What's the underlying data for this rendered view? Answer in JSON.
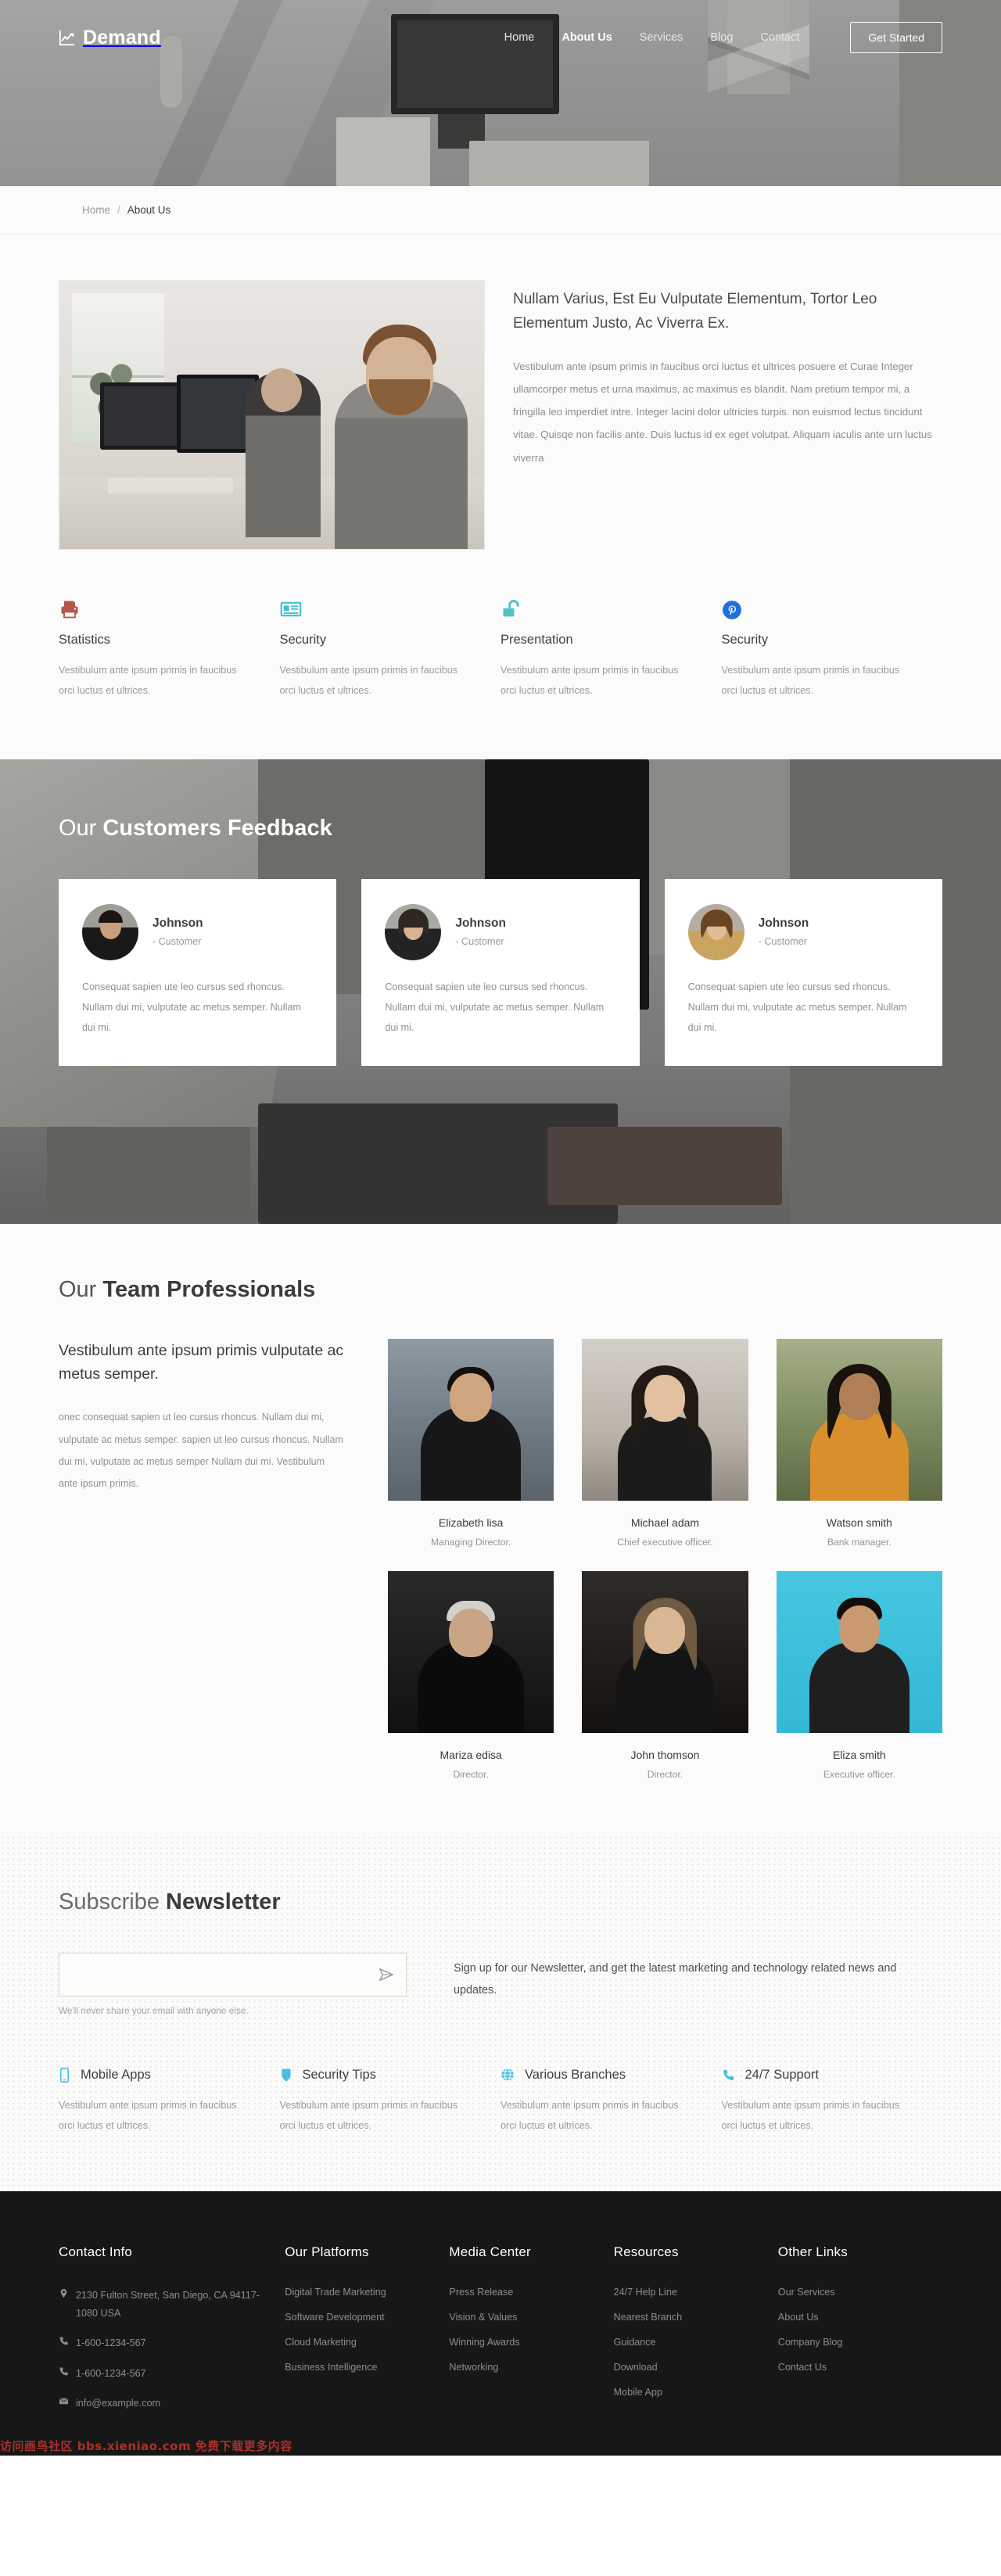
{
  "header": {
    "brand": "Demand",
    "brand_icon": "chart-line-icon",
    "nav": [
      {
        "label": "Home",
        "active": false
      },
      {
        "label": "About Us",
        "active": true
      },
      {
        "label": "Services",
        "active": false
      },
      {
        "label": "Blog",
        "active": false
      },
      {
        "label": "Contact",
        "active": false
      }
    ],
    "cta": "Get Started"
  },
  "breadcrumb": {
    "home": "Home",
    "separator": "/",
    "current": "About Us"
  },
  "about": {
    "title": "Nullam Varius, Est Eu Vulputate Elementum, Tortor Leo Elementum Justo, Ac Viverra Ex.",
    "body": "Vestibulum ante ipsum primis in faucibus orci luctus et ultrices posuere et Curae Integer ullamcorper metus et urna maximus, ac maximus es blandit. Nam pretium tempor mi, a fringilla leo imperdiet intre. Integer lacini dolor ultricies turpis. non euismod lectus tincidunt vitae. Quisqe non facilis ante. Duis luctus id ex eget volutpat. Aliquam iaculis ante urn luctus viverra"
  },
  "features": [
    {
      "icon": "printer-icon",
      "color": "#b5564a",
      "title": "Statistics",
      "desc": "Vestibulum ante ipsum primis in faucibus orci luctus et ultrices."
    },
    {
      "icon": "newspaper-icon",
      "color": "#3fc1d4",
      "title": "Security",
      "desc": "Vestibulum ante ipsum primis in faucibus orci luctus et ultrices."
    },
    {
      "icon": "unlock-icon",
      "color": "#4fc3c6",
      "title": "Presentation",
      "desc": "Vestibulum ante ipsum primis in faucibus orci luctus et ultrices."
    },
    {
      "icon": "pinterest-icon",
      "color": "#1f6fdd",
      "title": "Security",
      "desc": "Vestibulum ante ipsum primis in faucibus orci luctus et ultrices."
    }
  ],
  "feedback": {
    "heading_light": "Our ",
    "heading_bold": "Customers Feedback",
    "cards": [
      {
        "name": "Johnson",
        "role": "- Customer",
        "quote": "Consequat sapien ute leo cursus sed rhoncus. Nullam dui mi, vulputate ac metus semper. Nullam dui mi."
      },
      {
        "name": "Johnson",
        "role": "- Customer",
        "quote": "Consequat sapien ute leo cursus sed rhoncus. Nullam dui mi, vulputate ac metus semper. Nullam dui mi."
      },
      {
        "name": "Johnson",
        "role": "- Customer",
        "quote": "Consequat sapien ute leo cursus sed rhoncus. Nullam dui mi, vulputate ac metus semper. Nullam dui mi."
      }
    ]
  },
  "team": {
    "heading_light": "Our ",
    "heading_bold": "Team Professionals",
    "subtitle": "Vestibulum ante ipsum primis vulputate ac metus semper.",
    "body": "onec consequat sapien ut leo cursus rhoncus. Nullam dui mi, vulputate ac metus semper. sapien ut leo cursus rhoncus. Nullam dui mi, vulputate ac metus semper Nullam dui mi. Vestibulum ante ipsum primis.",
    "members": [
      {
        "name": "Elizabeth lisa",
        "role": "Managing Director."
      },
      {
        "name": "Michael adam",
        "role": "Chief executive officer."
      },
      {
        "name": "Watson smith",
        "role": "Bank manager."
      },
      {
        "name": "Mariza edisa",
        "role": "Director."
      },
      {
        "name": "John thomson",
        "role": "Director."
      },
      {
        "name": "Eliza smith",
        "role": "Executive officer."
      }
    ]
  },
  "newsletter": {
    "heading_light": "Subscribe ",
    "heading_bold": "Newsletter",
    "input_value": "",
    "input_placeholder": "",
    "send_icon": "paper-plane-icon",
    "note": "We'll never share your email with anyone else.",
    "copy": "Sign up for our Newsletter, and get the latest marketing and technology related news and updates."
  },
  "bottom_features": [
    {
      "icon": "mobile-icon",
      "color": "#4bbfe0",
      "title": "Mobile Apps",
      "desc": "Vestibulum ante ipsum primis in faucibus orci luctus et ultrices."
    },
    {
      "icon": "shield-icon",
      "color": "#4bbfe0",
      "title": "Security Tips",
      "desc": "Vestibulum ante ipsum primis in faucibus orci luctus et ultrices."
    },
    {
      "icon": "globe-icon",
      "color": "#4bbfe0",
      "title": "Various Branches",
      "desc": "Vestibulum ante ipsum primis in faucibus orci luctus et ultrices."
    },
    {
      "icon": "phone-icon",
      "color": "#4bbfe0",
      "title": "24/7 Support",
      "desc": "Vestibulum ante ipsum primis in faucibus orci luctus et ultrices."
    }
  ],
  "footer": {
    "contact": {
      "title": "Contact Info",
      "address": "2130 Fulton Street, San Diego, CA 94117-1080 USA",
      "phone1": "1-600-1234-567",
      "phone2": "1-600-1234-567",
      "email": "info@example.com"
    },
    "platforms": {
      "title": "Our Platforms",
      "links": [
        "Digital Trade Marketing",
        "Software Development",
        "Cloud Marketing",
        "Business Intelligence"
      ]
    },
    "media": {
      "title": "Media Center",
      "links": [
        "Press Release",
        "Vision & Values",
        "Winning Awards",
        "Networking"
      ]
    },
    "resources": {
      "title": "Resources",
      "links": [
        "24/7 Help Line",
        "Nearest Branch",
        "Guidance",
        "Download",
        "Mobile App"
      ]
    },
    "other": {
      "title": "Other Links",
      "links": [
        "Our Services",
        "About Us",
        "Company Blog",
        "Contact Us"
      ]
    }
  },
  "watermark": "访问画鸟社区 bbs.xieniao.com 免费下载更多内容"
}
